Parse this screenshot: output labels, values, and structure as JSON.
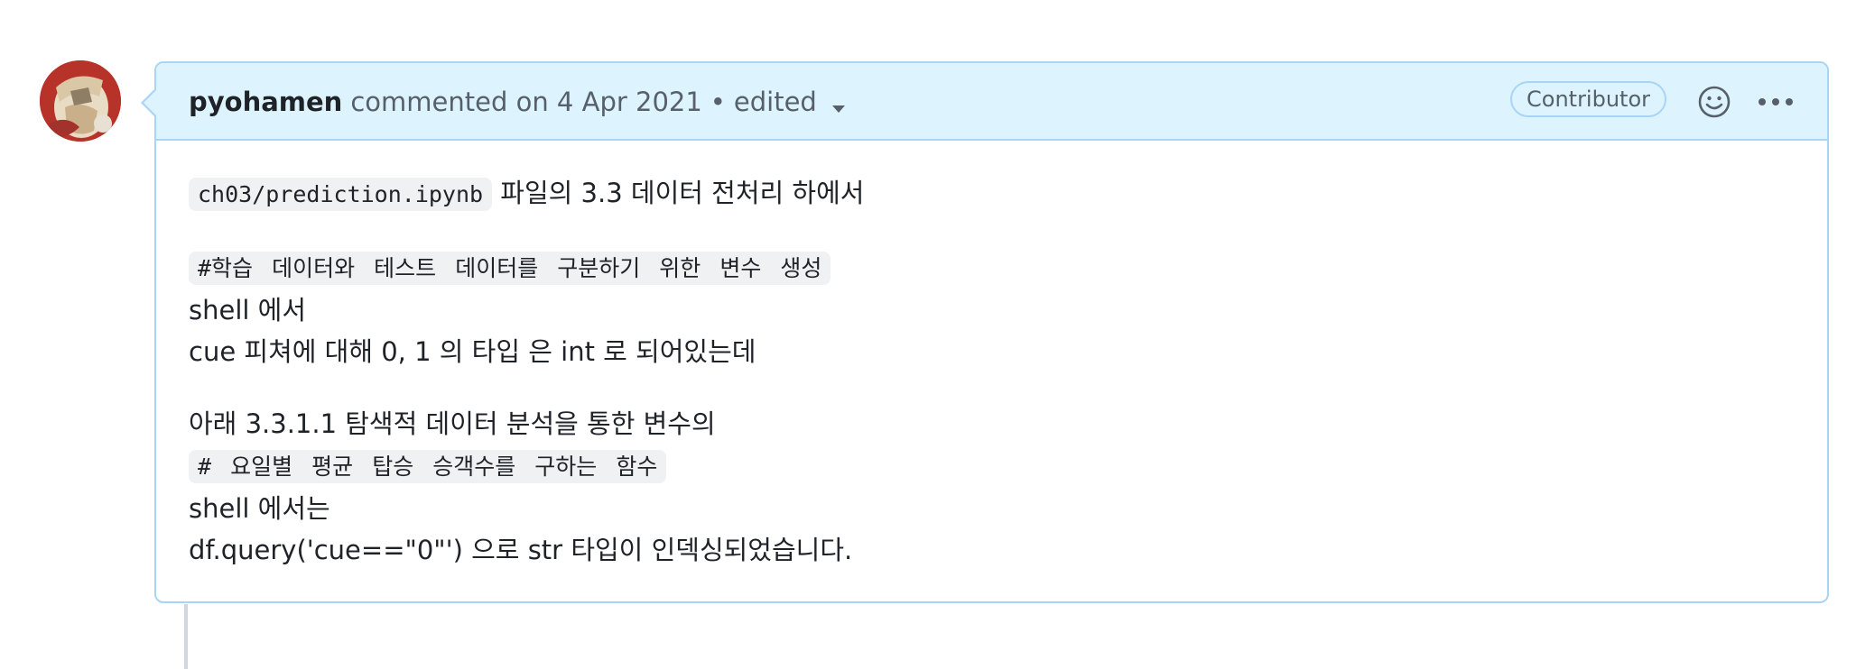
{
  "comment": {
    "author": "pyohamen",
    "meta": "commented on 4 Apr 2021",
    "separator": "•",
    "edited": "edited",
    "badge": "Contributor",
    "body": {
      "p1_code": "ch03/prediction.ipynb",
      "p1_text": " 파일의 3.3 데이터 전처리 하에서",
      "p2_code": "#학습 데이터와 테스트 데이터를 구분하기 위한 변수 생성",
      "p2_line2": "shell 에서",
      "p2_line3": "cue 피쳐에 대해 0, 1 의 타입 은 int 로 되어있는데",
      "p3_line1": "아래 3.3.1.1 탐색적 데이터 분석을 통한 변수의",
      "p3_code": "# 요일별 평균 탑승 승객수를 구하는 함수",
      "p3_line3": "shell 에서는",
      "p3_line4": "df.query('cue==\"0\"') 으로 str 타입이 인덱싱되었습니다."
    }
  },
  "icons": {
    "avatar": "avatar-image",
    "edited_menu": "chevron-down-icon",
    "reaction": "smiley-icon",
    "options": "kebab-horizontal-icon"
  },
  "colors": {
    "header_bg": "#ddf4ff",
    "border": "#a8d4f5",
    "code_bg": "#eff1f3",
    "text": "#1f2328",
    "muted": "#57606a"
  }
}
